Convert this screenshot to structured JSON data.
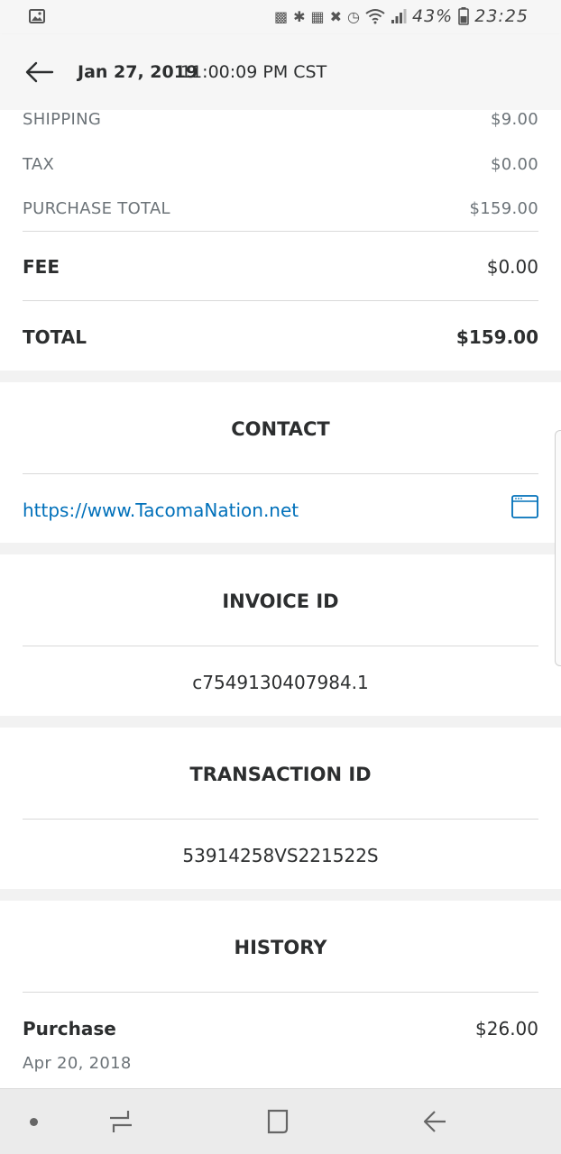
{
  "status_bar": {
    "battery": "43%",
    "time": "23:25"
  },
  "header": {
    "date": "Jan 27, 2019",
    "time": "11:00:09 PM CST"
  },
  "summary": {
    "rows": [
      {
        "label": "SHIPPING",
        "value": "$9.00"
      },
      {
        "label": "TAX",
        "value": "$0.00"
      },
      {
        "label": "PURCHASE TOTAL",
        "value": "$159.00"
      }
    ],
    "fee": {
      "label": "FEE",
      "value": "$0.00"
    },
    "total": {
      "label": "TOTAL",
      "value": "$159.00"
    }
  },
  "contact": {
    "title": "CONTACT",
    "url": "https://www.TacomaNation.net"
  },
  "invoice": {
    "title": "INVOICE ID",
    "value": "c7549130407984.1"
  },
  "transaction": {
    "title": "TRANSACTION ID",
    "value": "53914258VS221522S"
  },
  "history": {
    "title": "HISTORY",
    "items": [
      {
        "type": "Purchase",
        "date": "Apr 20, 2018",
        "amount": "$26.00"
      }
    ]
  },
  "icons": {
    "status_left": "image-notification-icon",
    "back": "back-arrow-icon",
    "browser": "browser-window-icon",
    "nav_recents": "recent-apps-icon",
    "nav_home": "home-icon",
    "nav_back": "back-icon"
  },
  "colors": {
    "link": "#0070ba",
    "text": "#2c2e2f",
    "muted": "#6c7378"
  }
}
